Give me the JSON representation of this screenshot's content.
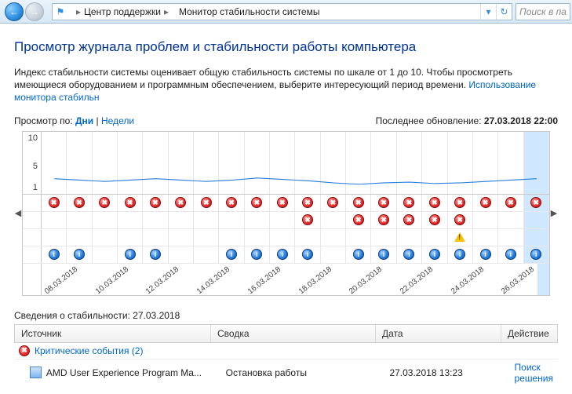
{
  "addressbar": {
    "crumb1": "Центр поддержки",
    "crumb2": "Монитор стабильности системы",
    "search_placeholder": "Поиск в па"
  },
  "page": {
    "title": "Просмотр журнала проблем и стабильности работы компьютера",
    "intro_text": "Индекс стабильности системы оценивает общую стабильность системы по шкале от 1 до 10. Чтобы просмотреть имеющиеся оборудованием и программным обеспечением, выберите интересующий период времени. ",
    "intro_link": "Использование монитора стабильн",
    "viewby_label": "Просмотр по:",
    "viewby_days": "Дни",
    "viewby_sep": " | ",
    "viewby_weeks": "Недели",
    "lastupdate_label": "Последнее обновление: ",
    "lastupdate_value": "27.03.2018 22:00"
  },
  "chart_data": {
    "type": "line",
    "ylim": [
      1,
      10
    ],
    "yticks": [
      1,
      5,
      10
    ],
    "selected_index": 19,
    "dates": [
      "08.03.2018",
      "",
      "10.03.2018",
      "",
      "12.03.2018",
      "",
      "14.03.2018",
      "",
      "16.03.2018",
      "",
      "18.03.2018",
      "",
      "20.03.2018",
      "",
      "22.03.2018",
      "",
      "24.03.2018",
      "",
      "26.03.2018",
      ""
    ],
    "stability": [
      3.2,
      3.0,
      2.8,
      3.0,
      3.2,
      3.0,
      2.8,
      3.0,
      3.3,
      3.1,
      2.9,
      2.6,
      2.4,
      2.6,
      2.7,
      2.5,
      2.6,
      2.8,
      3.0,
      3.2
    ],
    "critical": [
      1,
      1,
      1,
      1,
      1,
      1,
      1,
      1,
      1,
      1,
      1,
      1,
      1,
      1,
      1,
      1,
      1,
      1,
      1,
      1
    ],
    "app_fail": [
      0,
      0,
      0,
      0,
      0,
      0,
      0,
      0,
      0,
      0,
      1,
      0,
      1,
      1,
      1,
      1,
      1,
      0,
      0,
      0
    ],
    "warnings": [
      0,
      0,
      0,
      0,
      0,
      0,
      0,
      0,
      0,
      0,
      0,
      0,
      0,
      0,
      0,
      0,
      1,
      0,
      0,
      0
    ],
    "info": [
      1,
      1,
      0,
      1,
      1,
      0,
      0,
      1,
      1,
      1,
      1,
      0,
      1,
      1,
      1,
      1,
      1,
      1,
      1,
      1
    ]
  },
  "details": {
    "header_prefix": "Сведения о стабильности: ",
    "header_date": "27.03.2018",
    "columns": {
      "source": "Источник",
      "summary": "Сводка",
      "date": "Дата",
      "action": "Действие"
    },
    "group_label": "Критические события",
    "group_count": "(2)",
    "items": [
      {
        "source": "AMD User Experience Program Ma...",
        "summary": "Остановка работы",
        "date": "27.03.2018 13:23",
        "action": "Поиск решения"
      }
    ]
  }
}
